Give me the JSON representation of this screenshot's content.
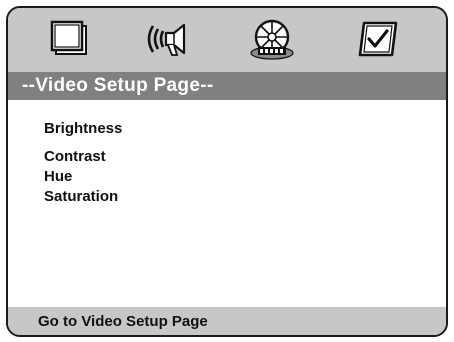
{
  "tabs": [
    {
      "icon": "general-setup-icon"
    },
    {
      "icon": "audio-speaker-icon"
    },
    {
      "icon": "video-disc-icon",
      "selected": true
    },
    {
      "icon": "preference-check-icon"
    }
  ],
  "title": "--Video Setup Page--",
  "menu": {
    "items": [
      {
        "label": "Brightness"
      },
      {
        "label": "Contrast"
      },
      {
        "label": "Hue"
      },
      {
        "label": "Saturation"
      }
    ]
  },
  "status": {
    "text": "Go to Video Setup Page"
  },
  "colors": {
    "bar_bg": "#c7c7c7",
    "title_bg": "#808080",
    "title_text": "#ffffff",
    "border": "#1a1a1a"
  }
}
